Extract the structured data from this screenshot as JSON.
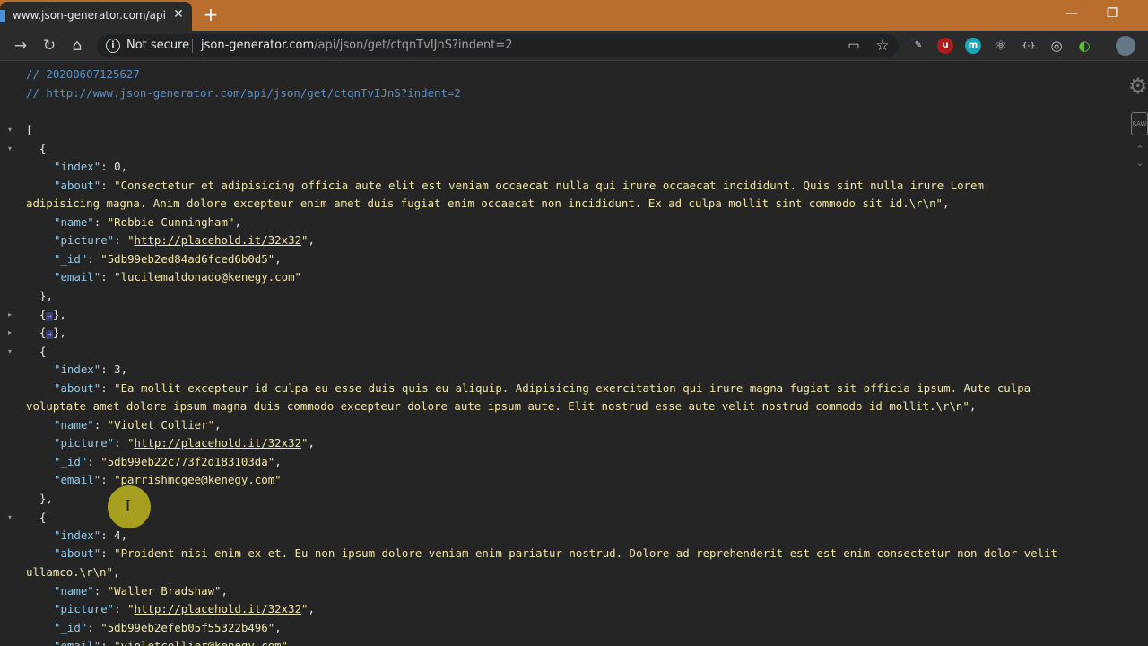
{
  "browser": {
    "tab_title": "www.json-generator.com/api/jso",
    "tab_close": "✕",
    "new_tab": "+",
    "window_minimize": "—",
    "window_restore": "❐",
    "security_label": "Not secure",
    "url_host": "json-generator.com",
    "url_path": "/api/json/get/ctqnTvIJnS?indent=2"
  },
  "icons": {
    "back": "→",
    "reload": "↻",
    "home": "⌂",
    "info": "i",
    "cast": "▭",
    "star": "☆",
    "gear": "⚙",
    "raw": "RAW",
    "up": "⌃",
    "down": "⌄",
    "collapse": "▾",
    "expand": "▸",
    "ibeam": "I",
    "ext_edit": "✎",
    "ext_ublock": "u",
    "ext_m": "m",
    "ext_react": "⚛",
    "ext_braces": "{-}",
    "ext_target": "◎",
    "ext_color": "◐"
  },
  "colors": {
    "titlebar": "#b96e2d",
    "comment": "#5a8fc6",
    "key": "#91c8e8",
    "string": "#f0e6a6",
    "cursor_highlight": "#d2c81e"
  },
  "json_viewer": {
    "comment_date": "// 20200607125627",
    "comment_url": "// http://www.json-generator.com/api/json/get/ctqnTvIJnS?indent=2",
    "open_bracket": "[",
    "collapsed_placeholder": "↔",
    "records": [
      {
        "index": "0",
        "about_line1": "\"Consectetur et adipisicing officia aute elit est veniam occaecat nulla qui irure occaecat incididunt. Quis sint nulla irure Lorem",
        "about_line2": "adipisicing magna. Anim dolore excepteur enim amet duis fugiat enim occaecat non incididunt. Ex ad culpa mollit sint commodo sit id.\\r\\n\"",
        "name": "\"Robbie Cunningham\"",
        "picture": "http://placehold.it/32x32",
        "_id": "\"5db99eb2ed84ad6fced6b0d5\"",
        "email": "\"lucilemaldonado@kenegy.com\""
      },
      {
        "index": "3",
        "about_line1": "\"Ea mollit excepteur id culpa eu esse duis quis eu aliquip. Adipisicing exercitation qui irure magna fugiat sit officia ipsum. Aute culpa",
        "about_line2": "voluptate amet dolore ipsum magna duis commodo excepteur dolore aute ipsum aute. Elit nostrud esse aute velit nostrud commodo id mollit.\\r\\n\"",
        "name": "\"Violet Collier\"",
        "picture": "http://placehold.it/32x32",
        "_id": "\"5db99eb22c773f2d183103da\"",
        "email": "\"parrishmcgee@kenegy.com\""
      },
      {
        "index": "4",
        "about_line1": "\"Proident nisi enim ex et. Eu non ipsum dolore veniam enim pariatur nostrud. Dolore ad reprehenderit est est enim consectetur non dolor velit",
        "about_line2": "ullamco.\\r\\n\"",
        "name": "\"Waller Bradshaw\"",
        "picture": "http://placehold.it/32x32",
        "_id": "\"5db99eb2efeb05f55322b496\"",
        "email": "\"violetcollier@kenegy.com\""
      }
    ]
  }
}
